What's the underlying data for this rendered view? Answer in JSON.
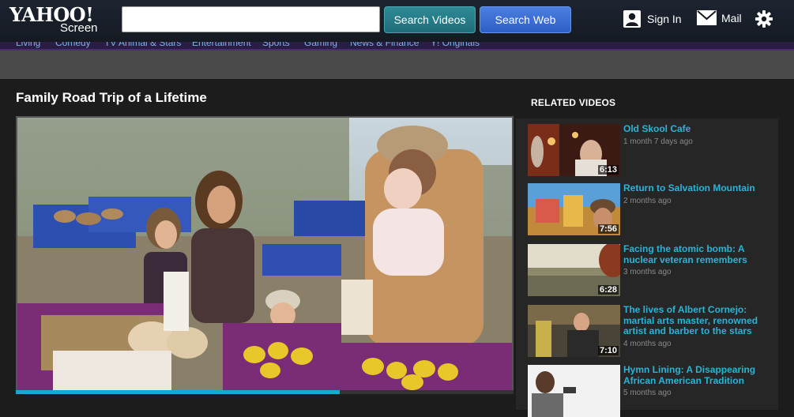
{
  "header": {
    "logo_yahoo": "YAHOO!",
    "logo_screen": "Screen",
    "search_placeholder": "",
    "search_videos_label": "Search Videos",
    "search_web_label": "Search Web",
    "sign_in_label": "Sign In",
    "mail_label": "Mail",
    "icons": [
      "user-icon",
      "mail-icon",
      "gear-icon"
    ]
  },
  "category_nav": [
    "Living",
    "Comedy",
    "TV Animal & Stars",
    "Entertainment",
    "Sports",
    "Gaming",
    "News & Finance",
    "Y! Originals"
  ],
  "video": {
    "title": "Family Road Trip of a Lifetime",
    "progress_fraction": 0.65
  },
  "related": {
    "heading": "RELATED VIDEOS",
    "items": [
      {
        "title": "Old Skool Cafe",
        "age": "1 month 7 days ago",
        "duration": "6:13"
      },
      {
        "title": "Return to Salvation Mountain",
        "age": "2 months ago",
        "duration": "7:56"
      },
      {
        "title": "Facing the atomic bomb: A nuclear veteran remembers",
        "age": "3 months ago",
        "duration": "6:28"
      },
      {
        "title": "The lives of Albert Cornejo: martial arts master, renowned artist and barber to the stars",
        "age": "4 months ago",
        "duration": "7:10"
      },
      {
        "title": "Hymn Lining: A Disappearing African American Tradition",
        "age": "5 months ago",
        "duration": ""
      }
    ]
  },
  "colors": {
    "accent_teal": "#2e8a96",
    "accent_blue": "#3a6fd8",
    "related_title": "#2bb3d6",
    "progress": "#1aa7d6"
  }
}
